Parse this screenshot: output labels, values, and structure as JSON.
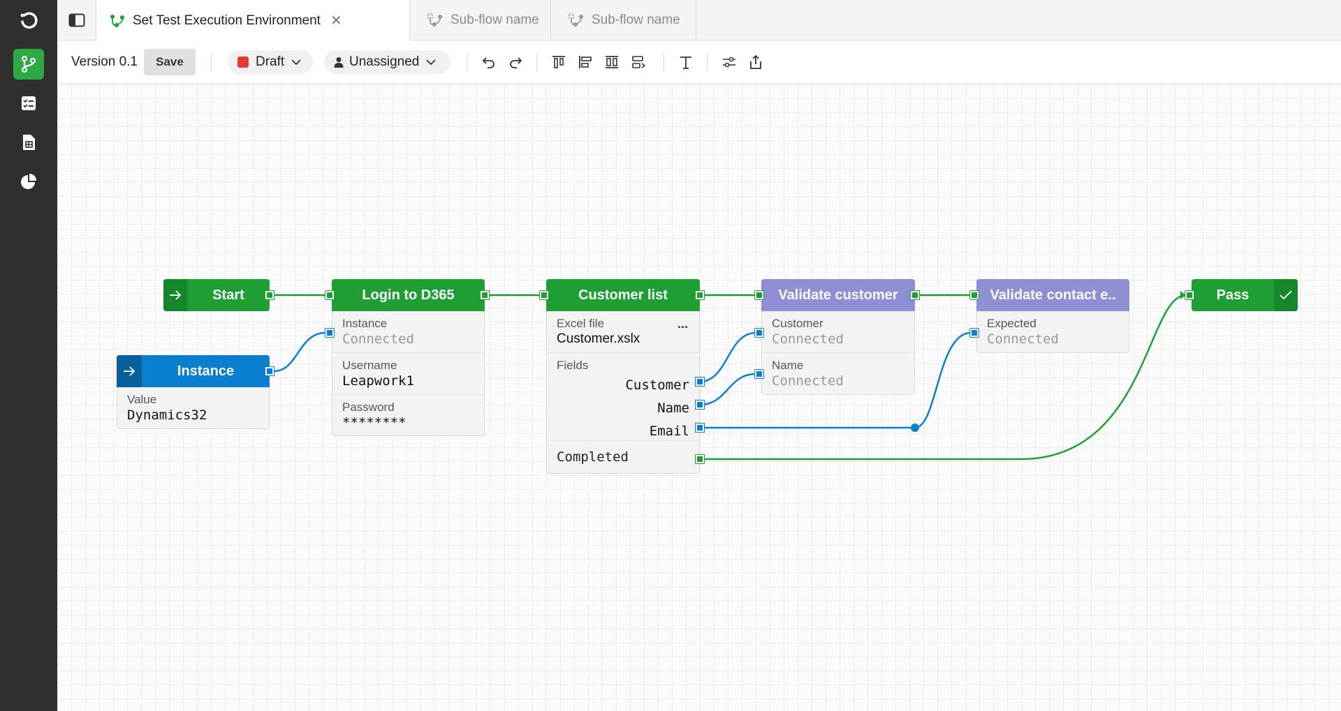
{
  "tabs": [
    {
      "label": "Set Test Execution Environment",
      "active": true
    },
    {
      "label": "Sub-flow name",
      "active": false
    },
    {
      "label": "Sub-flow name",
      "active": false
    }
  ],
  "toolbar": {
    "version": "Version 0.1",
    "save_label": "Save",
    "status_label": "Draft",
    "assignee_label": "Unassigned"
  },
  "nodes": {
    "start": {
      "title": "Start"
    },
    "instance": {
      "title": "Instance",
      "value_label": "Value",
      "value": "Dynamics32"
    },
    "login": {
      "title": "Login to D365",
      "instance_label": "Instance",
      "instance_value": "Connected",
      "username_label": "Username",
      "username_value": "Leapwork1",
      "password_label": "Password",
      "password_value": "********"
    },
    "customer_list": {
      "title": "Customer list",
      "excel_label": "Excel file",
      "excel_value": "Customer.xslx",
      "more": "...",
      "fields_label": "Fields",
      "field_customer": "Customer",
      "field_name": "Name",
      "field_email": "Email",
      "completed": "Completed"
    },
    "validate_customer": {
      "title": "Validate customer",
      "customer_label": "Customer",
      "customer_value": "Connected",
      "name_label": "Name",
      "name_value": "Connected"
    },
    "validate_contact": {
      "title": "Validate contact e..",
      "expected_label": "Expected",
      "expected_value": "Connected"
    },
    "pass": {
      "title": "Pass"
    }
  },
  "colors": {
    "green": "#1e9e35",
    "blue": "#0a7fd0",
    "purple": "#8f8fd6",
    "rail": "#2f2f2f",
    "draft_red": "#e53935"
  }
}
